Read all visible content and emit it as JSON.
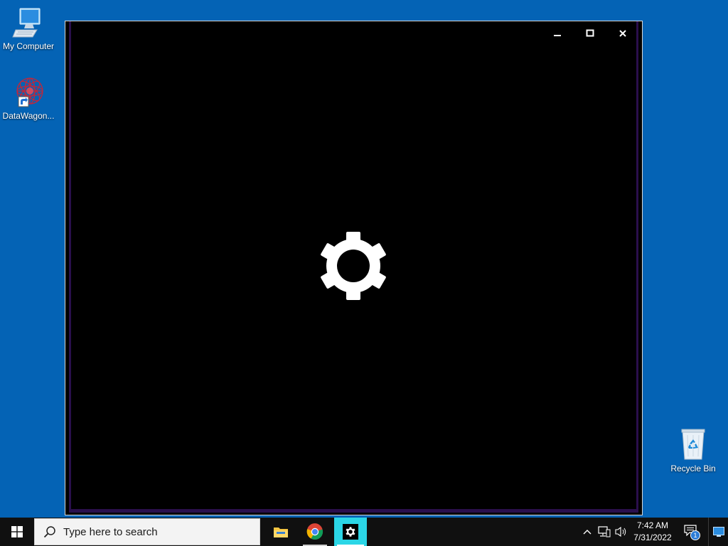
{
  "desktop": {
    "icons": [
      {
        "label": "My Computer",
        "icon": "computer-icon"
      },
      {
        "label": "DataWagon...",
        "icon": "datawagon-shortcut-icon"
      },
      {
        "label": "Recycle Bin",
        "icon": "recycle-bin-icon"
      }
    ]
  },
  "app_window": {
    "controls": {
      "minimize": "minimize-icon",
      "maximize": "maximize-icon",
      "close": "close-icon"
    },
    "content_icon": "gear-icon",
    "colors": {
      "background": "#000000",
      "frame": "#2a0f4c",
      "gear": "#ffffff"
    }
  },
  "taskbar": {
    "start_icon": "windows-logo-icon",
    "search_placeholder": "Type here to search",
    "pinned": [
      {
        "name": "File Explorer",
        "icon": "folder-icon"
      },
      {
        "name": "Google Chrome",
        "icon": "chrome-icon"
      },
      {
        "name": "Settings",
        "icon": "gear-icon",
        "active": true
      }
    ],
    "tray": {
      "time": "7:42 AM",
      "date": "7/31/2022",
      "notification_count": "1"
    },
    "colors": {
      "taskbar": "#101010",
      "active_app": "#2bd6e6",
      "desktop": "#0463b5"
    }
  }
}
